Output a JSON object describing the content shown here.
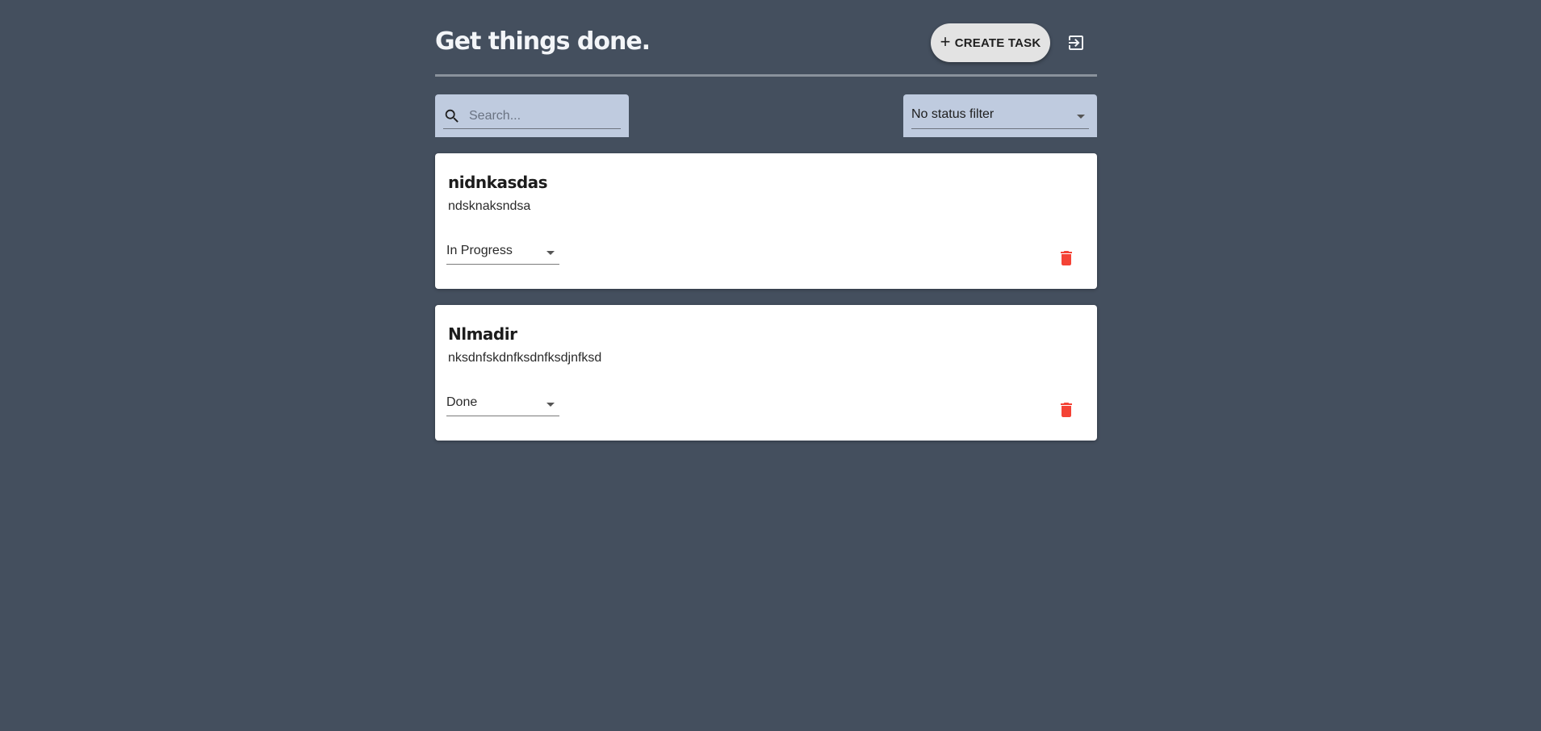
{
  "header": {
    "title": "Get things done.",
    "create_label": "CREATE TASK",
    "create_icon": "plus-icon",
    "logout_icon": "logout-icon"
  },
  "search": {
    "placeholder": "Search...",
    "value": "",
    "icon": "search-icon"
  },
  "filter": {
    "selected": "No status filter"
  },
  "tasks": [
    {
      "title": "nidnkasdas",
      "description": "ndsknaksndsa",
      "status": "In Progress"
    },
    {
      "title": "Nlmadir",
      "description": "nksdnfskdnfksdnfksdjnfksd",
      "status": "Done"
    }
  ],
  "colors": {
    "background": "#444f5e",
    "field_background": "#bfcbdf",
    "delete_icon": "#f44336",
    "card": "#ffffff"
  }
}
